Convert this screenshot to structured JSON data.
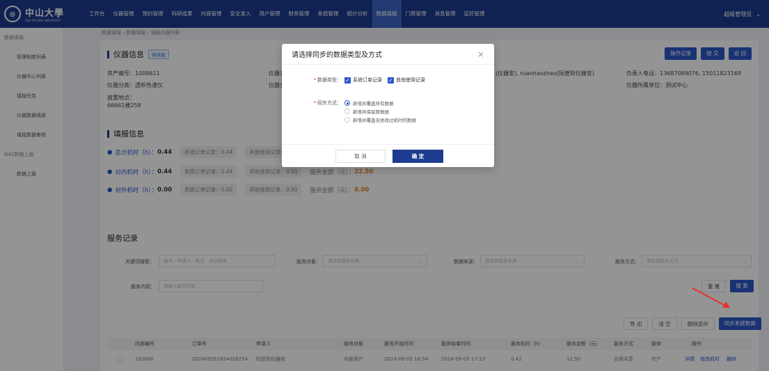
{
  "brand": {
    "name_cn": "中山大學",
    "name_en": "SUN YAT-SEN UNIVERSITY",
    "seal_glyph": "⊛"
  },
  "menu": [
    {
      "label": "工作台"
    },
    {
      "label": "仪器管理"
    },
    {
      "label": "预约管理"
    },
    {
      "label": "科研成果"
    },
    {
      "label": "内容管理"
    },
    {
      "label": "安全准入"
    },
    {
      "label": "用户管理"
    },
    {
      "label": "财务管理"
    },
    {
      "label": "系统管理"
    },
    {
      "label": "统计分析"
    },
    {
      "label": "数据填报"
    },
    {
      "label": "门禁管理"
    },
    {
      "label": "消息管理"
    },
    {
      "label": "监控管理"
    }
  ],
  "menu_active_index": 10,
  "user": {
    "name": "超级管理员",
    "chevron": "⌄"
  },
  "sidebar": {
    "items": [
      {
        "label": "数据填报",
        "group": true
      },
      {
        "label": "管理制度列表"
      },
      {
        "label": "仪器中心列表"
      },
      {
        "label": "填报任务"
      },
      {
        "label": "仪器数据填报"
      },
      {
        "label": "填报数据审核"
      },
      {
        "label": "NAS数据上报",
        "group": true
      },
      {
        "label": "数据上报"
      }
    ]
  },
  "breadcrumb": "数据填报  ›  数据填报  ›  填报仪器列表",
  "instrument": {
    "title": "仪器信息",
    "status_tag": "待填报",
    "buttons": {
      "log": "操作记录",
      "submit": "提 交",
      "back": "返 回"
    },
    "asset_no": "资产编号：1008611",
    "name_label": "仪器名",
    "category": "仪器分类：透析色谱仪",
    "amount_label": "仪器金",
    "location_label": "放置地点：",
    "location_value": "66661楼258",
    "admins": "(仪器安), ruanhaozhao(阮德到仪器安)",
    "phone": "负责人电话：13687089076, 15011823169",
    "unit": "仪器所属单位：测试中心"
  },
  "fill_info": {
    "title": "填报信息",
    "rows": [
      {
        "label": "总计机时（h）：",
        "value": "0.44",
        "pill1": "系统订单记录：0.44",
        "pill2": "其他使用记录：",
        "money_label": "",
        "money": ""
      },
      {
        "label": "对内机时（h）：",
        "value": "0.44",
        "pill1": "系统订单记录：0.44",
        "pill2": "其他使用记录：0.00",
        "money_label": "服务金额（元）：",
        "money": "22.50"
      },
      {
        "label": "对外机时（h）：",
        "value": "0.00",
        "pill1": "系统订单记录：0.00",
        "pill2": "其他使用记录：0.00",
        "money_label": "服务金额（元）：",
        "money": "0.00"
      }
    ]
  },
  "service": {
    "title": "服务记录",
    "filters": {
      "keyword_label": "关键词搜索：",
      "keyword_ph": "编号、申请人、电话、单位搜索",
      "target_label": "服务对象：",
      "target_ph": "请选择服务对象",
      "source_label": "数据来源：",
      "source_ph": "请选择数据来源",
      "mode_label": "服务方式：",
      "mode_ph": "请选择服务方式",
      "content_label": "服务内容：",
      "content_ph": "请输入服务内容"
    },
    "buttons": {
      "reset": "重 置",
      "search": "搜 索",
      "export": "导 出",
      "clear": "清 空",
      "delete_selected": "删除选中",
      "sync": "同步系统数据"
    },
    "columns": [
      "内部编号",
      "订单号",
      "申请人",
      "服务对象",
      "服务开始时间",
      "服务结束时间",
      "服务机时（h）",
      "服务金额（元）",
      "服务方式",
      "服务",
      "操作"
    ],
    "rows": [
      {
        "id": "193680",
        "order": "202409051654016254",
        "applicant": "阮德到仪器安",
        "target": "内部用户",
        "start": "2024-09-05 16:54",
        "end": "2024-09-05 17:19",
        "hours": "0.42",
        "amount": "12.50",
        "mode": "合用共享",
        "svc": "农产",
        "ops": [
          "详情",
          "修改机时",
          "删除"
        ]
      }
    ]
  },
  "modal": {
    "title": "请选择同步的数据类型及方式",
    "close": "×",
    "type_label": "数据类型：",
    "types": [
      {
        "label": "系统订单记录",
        "checked": true
      },
      {
        "label": "其他使用记录",
        "checked": true
      }
    ],
    "mode_label": "同步方式：",
    "modes": [
      {
        "label": "新增并覆盖所有数据",
        "selected": true
      },
      {
        "label": "新增并保留原数据",
        "selected": false
      },
      {
        "label": "新增并覆盖无修改过机时的数据",
        "selected": false
      }
    ],
    "cancel": "取 消",
    "confirm": "确 定"
  },
  "colors": {
    "nav": "#1d3c8f",
    "accent": "#2b56c9",
    "annotation_arrow": "#e5302a",
    "money": "#e67e22"
  }
}
